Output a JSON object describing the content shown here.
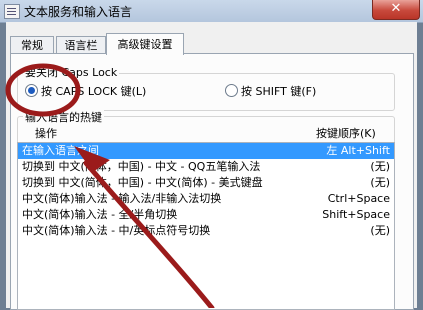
{
  "window": {
    "title": "文本服务和输入语言",
    "close_glyph": "✕"
  },
  "tabs": [
    {
      "label": "常规"
    },
    {
      "label": "语言栏"
    },
    {
      "label": "高级键设置"
    }
  ],
  "caps_lock_group": {
    "label": "要关闭 Caps Lock",
    "options": [
      {
        "label": "按 CAPS LOCK 键(L)",
        "selected": true
      },
      {
        "label": "按 SHIFT 键(F)",
        "selected": false
      }
    ]
  },
  "hotkeys_group": {
    "label": "输入语言的热键",
    "columns": {
      "action": "操作",
      "key": "按键顺序(K)"
    },
    "rows": [
      {
        "action": "在输入语言之间",
        "key": "左 Alt+Shift",
        "selected": true
      },
      {
        "action": "切换到 中文(简体，中国) - 中文 - QQ五笔输入法",
        "key": "(无)"
      },
      {
        "action": "切换到 中文(简体，中国) - 中文(简体) - 美式键盘",
        "key": "(无)"
      },
      {
        "action": "中文(简体)输入法 - 输入法/非输入法切换",
        "key": "Ctrl+Space"
      },
      {
        "action": "中文(简体)输入法 - 全/半角切换",
        "key": "Shift+Space"
      },
      {
        "action": "中文(简体)输入法 - 中/英标点符号切换",
        "key": "(无)"
      }
    ]
  },
  "colors": {
    "annotation": "#9b1b1b",
    "selection": "#3399ff",
    "close_button": "#c8493c"
  }
}
